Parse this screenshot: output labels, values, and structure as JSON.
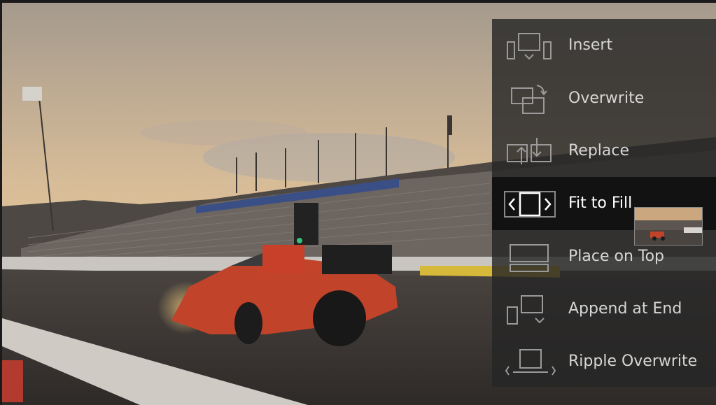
{
  "menu": {
    "items": [
      {
        "label": "Insert",
        "icon": "insert-icon"
      },
      {
        "label": "Overwrite",
        "icon": "overwrite-icon"
      },
      {
        "label": "Replace",
        "icon": "replace-icon"
      },
      {
        "label": "Fit to Fill",
        "icon": "fit-to-fill-icon",
        "active": true
      },
      {
        "label": "Place on Top",
        "icon": "place-on-top-icon"
      },
      {
        "label": "Append at End",
        "icon": "append-at-end-icon"
      },
      {
        "label": "Ripple Overwrite",
        "icon": "ripple-overwrite-icon"
      }
    ]
  },
  "colors": {
    "overlay": "#262626",
    "active_row": "#0e0e0e",
    "text": "#d6d6d6",
    "active_text": "#ffffff",
    "icon_stroke": "#9a9a9a"
  }
}
